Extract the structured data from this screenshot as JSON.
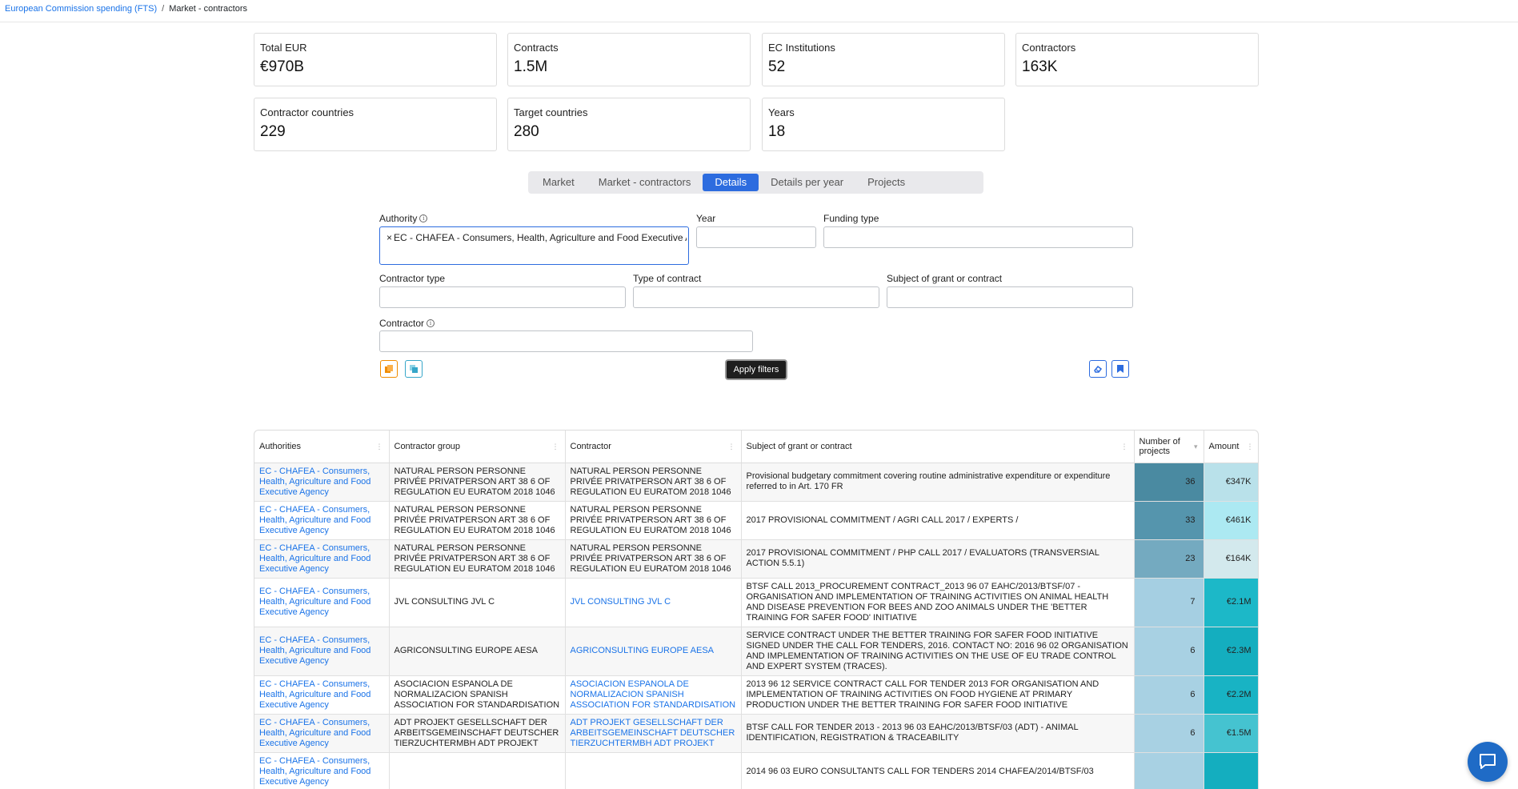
{
  "breadcrumb": {
    "root": "European Commission spending (FTS)",
    "sep": "/",
    "current": "Market - contractors"
  },
  "kpis": [
    {
      "label": "Total EUR",
      "value": "€970B"
    },
    {
      "label": "Contracts",
      "value": "1.5M"
    },
    {
      "label": "EC Institutions",
      "value": "52"
    },
    {
      "label": "Contractors",
      "value": "163K"
    },
    {
      "label": "Contractor countries",
      "value": "229"
    },
    {
      "label": "Target countries",
      "value": "280"
    },
    {
      "label": "Years",
      "value": "18"
    }
  ],
  "tabs": [
    "Market",
    "Market - contractors",
    "Details",
    "Details per year",
    "Projects"
  ],
  "active_tab": "Details",
  "filters": {
    "authority_label": "Authority",
    "authority_value": "EC - CHAFEA - Consumers, Health, Agriculture and Food Executive Agency",
    "chip_remove": "×",
    "year_label": "Year",
    "funding_label": "Funding type",
    "contractor_type_label": "Contractor type",
    "type_of_contract_label": "Type of contract",
    "subject_label": "Subject of grant or contract",
    "contractor_label": "Contractor",
    "info_glyph": "i",
    "apply_label": "Apply filters"
  },
  "table": {
    "headers": [
      "Authorities",
      "Contractor group",
      "Contractor",
      "Subject of grant or contract",
      "Number of projects",
      "Amount"
    ],
    "rows": [
      {
        "authority": "EC - CHAFEA - Consumers, Health, Agriculture and Food Executive Agency",
        "group": "NATURAL PERSON PERSONNE PRIVÉE PRIVATPERSON ART 38 6 OF REGULATION EU EURATOM 2018 1046",
        "contractor": "NATURAL PERSON PERSONNE PRIVÉE PRIVATPERSON ART 38 6 OF REGULATION EU EURATOM 2018 1046",
        "contractor_link": false,
        "subject": "Provisional budgetary commitment covering routine administrative expenditure or expenditure referred to in Art. 170 FR",
        "projects": "36",
        "amount": "€347K",
        "projects_color": "#4a8aa1",
        "amount_color": "#b9e1ea"
      },
      {
        "authority": "EC - CHAFEA - Consumers, Health, Agriculture and Food Executive Agency",
        "group": "NATURAL PERSON PERSONNE PRIVÉE PRIVATPERSON ART 38 6 OF REGULATION EU EURATOM 2018 1046",
        "contractor": "NATURAL PERSON PERSONNE PRIVÉE PRIVATPERSON ART 38 6 OF REGULATION EU EURATOM 2018 1046",
        "contractor_link": false,
        "subject": "2017 PROVISIONAL COMMITMENT / AGRI CALL 2017 / EXPERTS /",
        "projects": "33",
        "amount": "€461K",
        "projects_color": "#5595ad",
        "amount_color": "#ace9f2"
      },
      {
        "authority": "EC - CHAFEA - Consumers, Health, Agriculture and Food Executive Agency",
        "group": "NATURAL PERSON PERSONNE PRIVÉE PRIVATPERSON ART 38 6 OF REGULATION EU EURATOM 2018 1046",
        "contractor": "NATURAL PERSON PERSONNE PRIVÉE PRIVATPERSON ART 38 6 OF REGULATION EU EURATOM 2018 1046",
        "contractor_link": false,
        "subject": "2017 PROVISIONAL COMMITMENT / PHP CALL 2017 / EVALUATORS (TRANSVERSIAL ACTION 5.5.1)",
        "projects": "23",
        "amount": "€164K",
        "projects_color": "#74aac0",
        "amount_color": "#d3e9ed"
      },
      {
        "authority": "EC - CHAFEA - Consumers, Health, Agriculture and Food Executive Agency",
        "group": "JVL CONSULTING JVL C",
        "contractor": "JVL CONSULTING JVL C",
        "contractor_link": true,
        "subject": "BTSF CALL 2013_PROCUREMENT CONTRACT_2013 96 07 EAHC/2013/BTSF/07 - ORGANISATION AND IMPLEMENTATION OF TRAINING ACTIVITIES ON ANIMAL HEALTH AND DISEASE PREVENTION FOR BEES AND ZOO ANIMALS UNDER THE 'BETTER TRAINING FOR SAFER FOOD' INITIATIVE",
        "projects": "7",
        "amount": "€2.1M",
        "projects_color": "#a5cfe2",
        "amount_color": "#1cb8c8"
      },
      {
        "authority": "EC - CHAFEA - Consumers, Health, Agriculture and Food Executive Agency",
        "group": "AGRICONSULTING EUROPE AESA",
        "contractor": "AGRICONSULTING EUROPE AESA",
        "contractor_link": true,
        "subject": "SERVICE CONTRACT UNDER THE BETTER TRAINING FOR SAFER FOOD INITIATIVE SIGNED UNDER THE CALL FOR TENDERS, 2016. CONTACT NO: 2016 96 02 ORGANISATION AND IMPLEMENTATION OF TRAINING ACTIVITIES ON THE USE OF EU TRADE CONTROL AND EXPERT SYSTEM (TRACES).",
        "projects": "6",
        "amount": "€2.3M",
        "projects_color": "#a8d1e3",
        "amount_color": "#14aebf"
      },
      {
        "authority": "EC - CHAFEA - Consumers, Health, Agriculture and Food Executive Agency",
        "group": "ASOCIACION ESPANOLA DE NORMALIZACION SPANISH ASSOCIATION FOR STANDARDISATION",
        "contractor": "ASOCIACION ESPANOLA DE NORMALIZACION SPANISH ASSOCIATION FOR STANDARDISATION",
        "contractor_link": true,
        "subject": "2013 96 12 SERVICE CONTRACT CALL FOR TENDER 2013 FOR ORGANISATION AND IMPLEMENTATION OF TRAINING ACTIVITIES ON FOOD HYGIENE AT PRIMARY PRODUCTION UNDER THE BETTER TRAINING FOR SAFER FOOD INITIATIVE",
        "projects": "6",
        "amount": "€2.2M",
        "projects_color": "#a8d1e3",
        "amount_color": "#18b3c4"
      },
      {
        "authority": "EC - CHAFEA - Consumers, Health, Agriculture and Food Executive Agency",
        "group": "ADT PROJEKT GESELLSCHAFT DER ARBEITSGEMEINSCHAFT DEUTSCHER TIERZUCHTERMBH ADT PROJEKT",
        "contractor": "ADT PROJEKT GESELLSCHAFT DER ARBEITSGEMEINSCHAFT DEUTSCHER TIERZUCHTERMBH ADT PROJEKT",
        "contractor_link": true,
        "subject": "BTSF CALL FOR TENDER 2013 - 2013 96 03 EAHC/2013/BTSF/03 (ADT) - ANIMAL IDENTIFICATION, REGISTRATION & TRACEABILITY",
        "projects": "6",
        "amount": "€1.5M",
        "projects_color": "#a8d1e3",
        "amount_color": "#45c3d0"
      },
      {
        "authority": "EC - CHAFEA - Consumers, Health, Agriculture and Food Executive Agency",
        "group": "",
        "contractor": "",
        "contractor_link": true,
        "subject": "2014 96 03 EURO CONSULTANTS CALL FOR TENDERS 2014 CHAFEA/2014/BTSF/03",
        "projects": "",
        "amount": "",
        "projects_color": "#a8d1e3",
        "amount_color": "#14aebf"
      }
    ]
  }
}
